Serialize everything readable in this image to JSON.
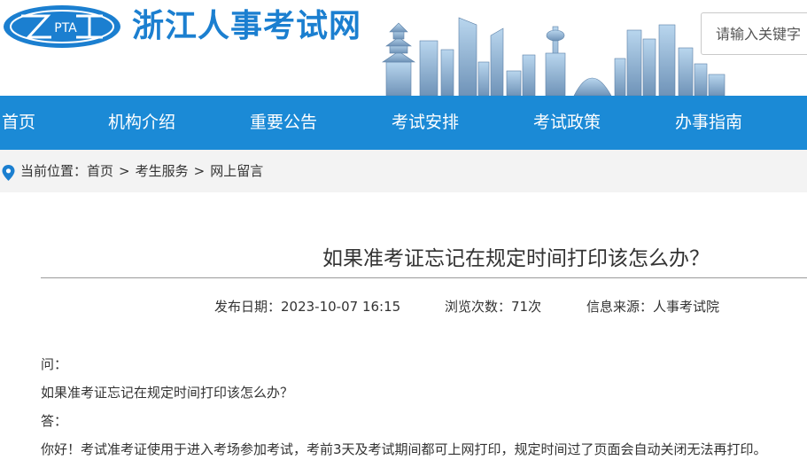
{
  "header": {
    "logo_text": "PTA",
    "site_name": "浙江人事考试网",
    "search_placeholder": "请输入关键字"
  },
  "nav": {
    "items": [
      {
        "label": "首页"
      },
      {
        "label": "机构介绍"
      },
      {
        "label": "重要公告"
      },
      {
        "label": "考试安排"
      },
      {
        "label": "考试政策"
      },
      {
        "label": "办事指南"
      }
    ]
  },
  "breadcrumb": {
    "prefix": "当前位置：",
    "items": [
      "首页",
      "考生服务",
      "网上留言"
    ],
    "separator": ">"
  },
  "article": {
    "title": "如果准考证忘记在规定时间打印该怎么办？",
    "publish_date": "发布日期：2023-10-07 16:15",
    "views": "浏览次数：71次",
    "source": "信息来源：人事考试院",
    "question_label": "问：",
    "question": "如果准考证忘记在规定时间打印该怎么办？",
    "answer_label": "答：",
    "answer": "你好！考试准考证使用于进入考场参加考试，考前3天及考试期间都可上网打印，规定时间过了页面会自动关闭无法再打印。"
  },
  "colors": {
    "brand_blue": "#1b8ad6",
    "logo_blue": "#1b7fd0",
    "breadcrumb_bg": "#f3f3f3"
  }
}
